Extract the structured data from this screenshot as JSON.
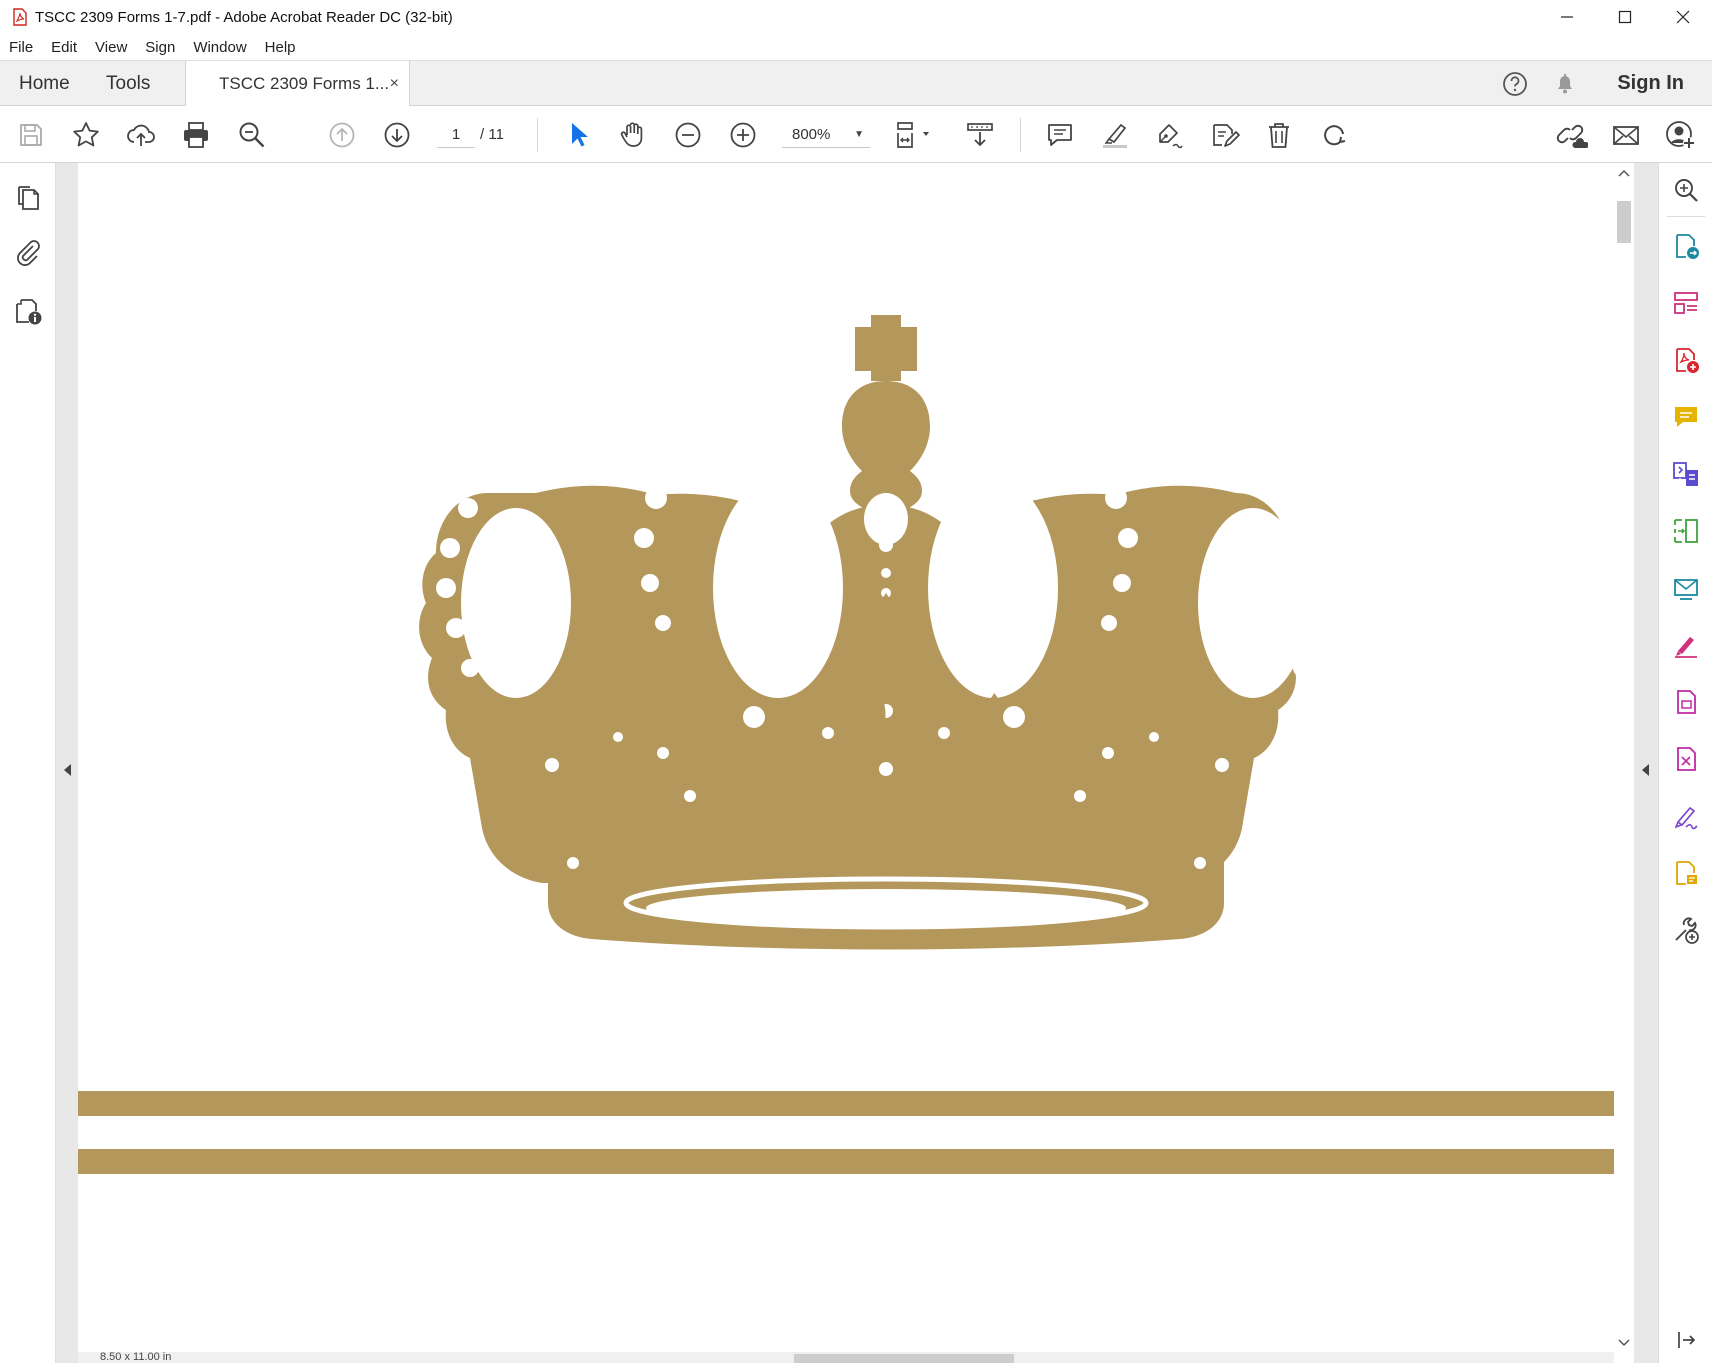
{
  "window": {
    "title": "TSCC 2309 Forms 1-7.pdf - Adobe Acrobat Reader DC (32-bit)",
    "minimize_glyph": "—",
    "maximize_glyph": "☐",
    "close_glyph": "✕"
  },
  "menu": [
    "File",
    "Edit",
    "View",
    "Sign",
    "Window",
    "Help"
  ],
  "tabs": {
    "home": "Home",
    "tools": "Tools",
    "document": "TSCC 2309 Forms 1...",
    "close_glyph": "×",
    "sign_in": "Sign In"
  },
  "toolbar": {
    "current_page": "1",
    "page_total": "/ 11",
    "zoom": "800%",
    "zoom_caret": "▼"
  },
  "status": {
    "page_size": "8.50 x 11.00 in"
  },
  "colors": {
    "gold": "#b4975a",
    "accent_blue": "#1473e6"
  },
  "icons": {
    "toolbar": [
      "save-icon",
      "bookmark-star-icon",
      "cloud-upload-icon",
      "print-icon",
      "search-zoom-icon",
      "previous-page-icon",
      "next-page-icon",
      "select-cursor-icon",
      "hand-icon",
      "zoom-out-icon",
      "zoom-in-icon",
      "fit-page-icon",
      "scroll-mode-icon",
      "comment-icon",
      "highlight-icon",
      "draw-icon",
      "fill-sign-icon",
      "delete-icon",
      "rotate-icon",
      "share-link-icon",
      "email-icon",
      "add-user-icon"
    ],
    "left_rail": [
      "page-thumbnails-icon",
      "attachments-icon",
      "document-properties-icon"
    ],
    "right_pane": [
      "search-tool-icon",
      "export-pdf-icon",
      "organize-pages-icon",
      "create-pdf-icon",
      "comment-tool-icon",
      "combine-files-icon",
      "compress-icon",
      "send-for-signature-icon",
      "fill-and-sign-icon",
      "edit-pdf-icon",
      "protect-icon",
      "certificates-icon",
      "request-signature-icon",
      "more-tools-icon"
    ]
  }
}
